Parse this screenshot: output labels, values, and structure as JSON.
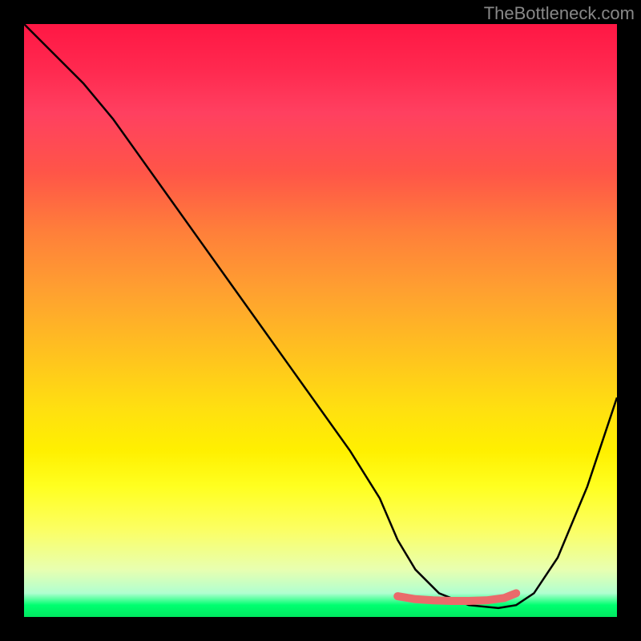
{
  "watermark": "TheBottleneck.com",
  "chart_data": {
    "type": "line",
    "title": "",
    "xlabel": "",
    "ylabel": "",
    "xlim": [
      0,
      100
    ],
    "ylim": [
      0,
      100
    ],
    "series": [
      {
        "name": "curve",
        "color": "#000000",
        "x": [
          0,
          5,
          10,
          15,
          20,
          25,
          30,
          35,
          40,
          45,
          50,
          55,
          60,
          63,
          66,
          70,
          75,
          80,
          83,
          86,
          90,
          95,
          100
        ],
        "y": [
          100,
          95,
          90,
          84,
          77,
          70,
          63,
          56,
          49,
          42,
          35,
          28,
          20,
          13,
          8,
          4,
          2,
          1.5,
          2,
          4,
          10,
          22,
          37
        ]
      },
      {
        "name": "marker",
        "color": "#ea6b6b",
        "type": "line",
        "x": [
          63,
          66,
          69,
          72,
          75,
          78,
          81,
          83
        ],
        "y": [
          3.5,
          3.0,
          2.8,
          2.7,
          2.7,
          2.8,
          3.2,
          4.0
        ]
      }
    ],
    "gradient_stops": [
      {
        "pos": 0,
        "color": "#ff1744"
      },
      {
        "pos": 50,
        "color": "#ffc020"
      },
      {
        "pos": 80,
        "color": "#ffff20"
      },
      {
        "pos": 100,
        "color": "#00e860"
      }
    ]
  }
}
